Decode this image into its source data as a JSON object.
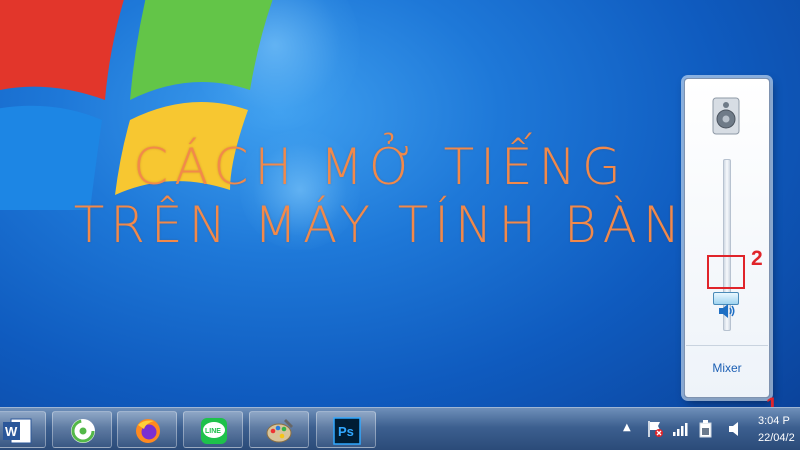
{
  "overlay": {
    "title_line_1": "CÁCH MỞ TIẾNG",
    "title_line_2": "TRÊN MÁY TÍNH BÀN"
  },
  "volume_flyout": {
    "mixer_label": "Mixer",
    "volume_level_percent": 12
  },
  "annotations": {
    "step_1": "1",
    "step_2": "2"
  },
  "taskbar": {
    "apps": [
      {
        "name": "word-icon"
      },
      {
        "name": "app-icon"
      },
      {
        "name": "firefox-icon"
      },
      {
        "name": "line-icon"
      },
      {
        "name": "paint-icon"
      },
      {
        "name": "photoshop-icon"
      }
    ],
    "line_label": "LINE",
    "photoshop_label": "Ps",
    "clock_time": "3:04 P",
    "clock_date": "22/04/2"
  },
  "colors": {
    "headline": "#f2894a",
    "highlight": "#e0242a",
    "accent_blue": "#1e78d8"
  }
}
